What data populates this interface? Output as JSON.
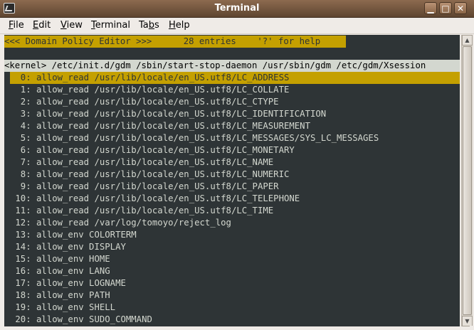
{
  "window": {
    "title": "Terminal",
    "controls": {
      "minimize": "▁",
      "maximize": "□",
      "close": "✕"
    }
  },
  "menubar": {
    "items": [
      {
        "pre": "",
        "mnemonic": "F",
        "post": "ile"
      },
      {
        "pre": "",
        "mnemonic": "E",
        "post": "dit"
      },
      {
        "pre": "",
        "mnemonic": "V",
        "post": "iew"
      },
      {
        "pre": "",
        "mnemonic": "T",
        "post": "erminal"
      },
      {
        "pre": "Ta",
        "mnemonic": "b",
        "post": "s"
      },
      {
        "pre": "",
        "mnemonic": "H",
        "post": "elp"
      }
    ]
  },
  "terminal": {
    "header": "<<< Domain Policy Editor >>>      28 entries    '?' for help",
    "domain": "<kernel> /etc/init.d/gdm /sbin/start-stop-daemon /usr/sbin/gdm /etc/gdm/Xsession",
    "selected_index": 0,
    "entries": [
      "  0: allow_read /usr/lib/locale/en_US.utf8/LC_ADDRESS",
      "  1: allow_read /usr/lib/locale/en_US.utf8/LC_COLLATE",
      "  2: allow_read /usr/lib/locale/en_US.utf8/LC_CTYPE",
      "  3: allow_read /usr/lib/locale/en_US.utf8/LC_IDENTIFICATION",
      "  4: allow_read /usr/lib/locale/en_US.utf8/LC_MEASUREMENT",
      "  5: allow_read /usr/lib/locale/en_US.utf8/LC_MESSAGES/SYS_LC_MESSAGES",
      "  6: allow_read /usr/lib/locale/en_US.utf8/LC_MONETARY",
      "  7: allow_read /usr/lib/locale/en_US.utf8/LC_NAME",
      "  8: allow_read /usr/lib/locale/en_US.utf8/LC_NUMERIC",
      "  9: allow_read /usr/lib/locale/en_US.utf8/LC_PAPER",
      " 10: allow_read /usr/lib/locale/en_US.utf8/LC_TELEPHONE",
      " 11: allow_read /usr/lib/locale/en_US.utf8/LC_TIME",
      " 12: allow_read /var/log/tomoyo/reject_log",
      " 13: allow_env COLORTERM",
      " 14: allow_env DISPLAY",
      " 15: allow_env HOME",
      " 16: allow_env LANG",
      " 17: allow_env LOGNAME",
      " 18: allow_env PATH",
      " 19: allow_env SHELL",
      " 20: allow_env SUDO_COMMAND"
    ]
  }
}
